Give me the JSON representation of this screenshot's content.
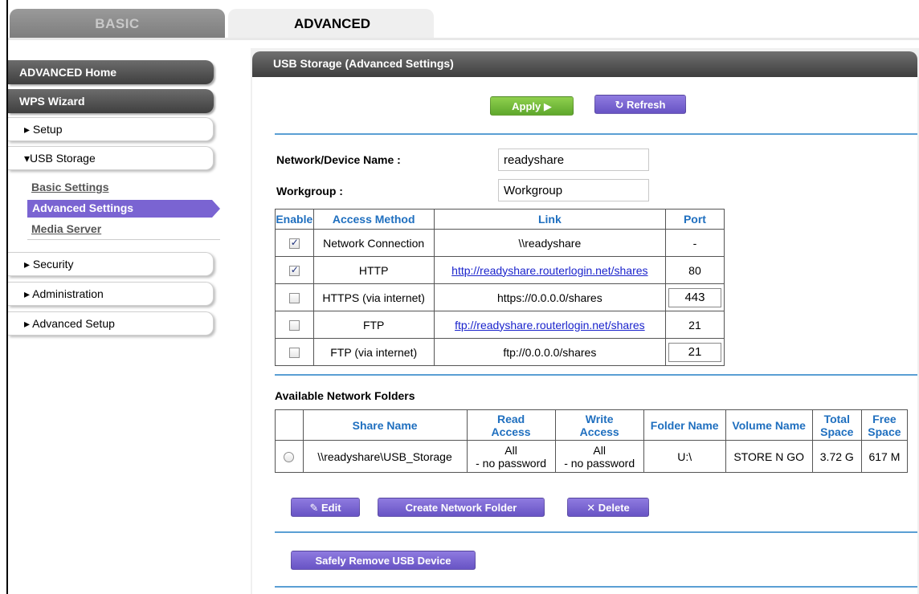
{
  "tabs": {
    "basic": "BASIC",
    "advanced": "ADVANCED"
  },
  "sidebar": {
    "advanced_home": "ADVANCED Home",
    "wps_wizard": "WPS Wizard",
    "setup": "▸ Setup",
    "usb_storage": "▾USB Storage",
    "usb_sub": {
      "basic_settings": "Basic Settings",
      "advanced_settings": "Advanced Settings",
      "media_server": "Media Server"
    },
    "security": "▸ Security",
    "administration": "▸ Administration",
    "advanced_setup": "▸ Advanced Setup"
  },
  "panel": {
    "title": "USB Storage (Advanced Settings)",
    "apply_label": "Apply ▶",
    "refresh_label": "↻ Refresh",
    "network_device_name_label": "Network/Device Name :",
    "network_device_name_value": "readyshare",
    "workgroup_label": "Workgroup :",
    "workgroup_value": "Workgroup"
  },
  "access_table": {
    "headers": [
      "Enable",
      "Access Method",
      "Link",
      "Port"
    ],
    "rows": [
      {
        "enabled": true,
        "method": "Network Connection",
        "link": "\\\\readyshare",
        "link_is_url": false,
        "port": "-",
        "port_editable": false
      },
      {
        "enabled": true,
        "method": "HTTP",
        "link": "http://readyshare.routerlogin.net/shares",
        "link_is_url": true,
        "port": "80",
        "port_editable": false
      },
      {
        "enabled": false,
        "method": "HTTPS (via internet)",
        "link": "https://0.0.0.0/shares",
        "link_is_url": false,
        "port": "443",
        "port_editable": true
      },
      {
        "enabled": false,
        "method": "FTP",
        "link": "ftp://readyshare.routerlogin.net/shares",
        "link_is_url": true,
        "port": "21",
        "port_editable": false
      },
      {
        "enabled": false,
        "method": "FTP (via internet)",
        "link": "ftp://0.0.0.0/shares",
        "link_is_url": false,
        "port": "21",
        "port_editable": true
      }
    ]
  },
  "folders": {
    "title": "Available Network Folders",
    "headers": {
      "share_name": "Share Name",
      "read_access_1": "Read",
      "read_access_2": "Access",
      "write_access_1": "Write",
      "write_access_2": "Access",
      "folder_name": "Folder Name",
      "volume_name": "Volume Name",
      "total_space_1": "Total",
      "total_space_2": "Space",
      "free_space_1": "Free",
      "free_space_2": "Space"
    },
    "rows": [
      {
        "share_name": "\\\\readyshare\\USB_Storage",
        "read_1": "All",
        "read_2": "- no password",
        "write_1": "All",
        "write_2": "- no password",
        "folder_name": "U:\\",
        "volume_name": "STORE N GO",
        "total_space": "3.72 G",
        "free_space": "617 M"
      }
    ],
    "edit_label": "✎ Edit",
    "create_label": "Create Network Folder",
    "delete_label": "✕ Delete",
    "safely_remove_label": "Safely Remove USB Device"
  },
  "colors": {
    "accent_purple": "#7a64d2",
    "apply_green": "#6fba38",
    "divider_blue": "#5a9fd4",
    "header_text_blue": "#1f6fbf",
    "link_blue": "#1a23cc"
  }
}
